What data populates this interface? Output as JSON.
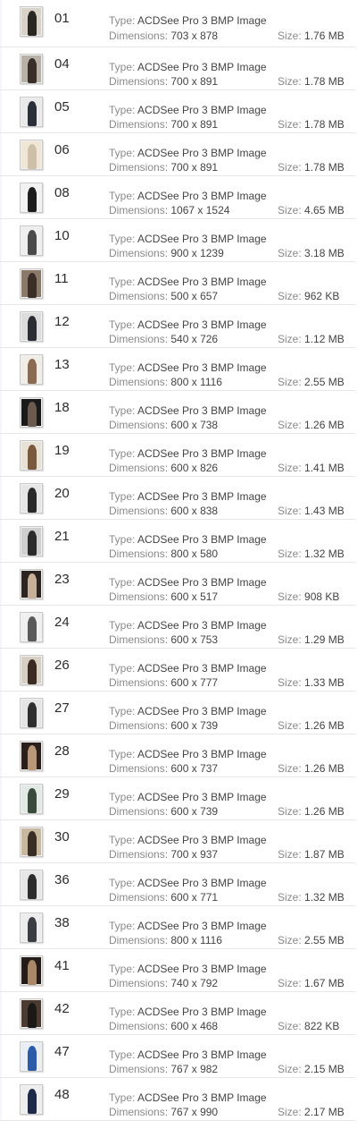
{
  "labels": {
    "type": "Type:",
    "dimensions": "Dimensions:",
    "size": "Size:"
  },
  "files": [
    {
      "name": "01",
      "type": "ACDSee Pro 3 BMP Image",
      "dimensions": "703 x 878",
      "size": "1.76 MB"
    },
    {
      "name": "04",
      "type": "ACDSee Pro 3 BMP Image",
      "dimensions": "700 x 891",
      "size": "1.78 MB"
    },
    {
      "name": "05",
      "type": "ACDSee Pro 3 BMP Image",
      "dimensions": "700 x 891",
      "size": "1.78 MB"
    },
    {
      "name": "06",
      "type": "ACDSee Pro 3 BMP Image",
      "dimensions": "700 x 891",
      "size": "1.78 MB"
    },
    {
      "name": "08",
      "type": "ACDSee Pro 3 BMP Image",
      "dimensions": "1067 x 1524",
      "size": "4.65 MB"
    },
    {
      "name": "10",
      "type": "ACDSee Pro 3 BMP Image",
      "dimensions": "900 x 1239",
      "size": "3.18 MB"
    },
    {
      "name": "11",
      "type": "ACDSee Pro 3 BMP Image",
      "dimensions": "500 x 657",
      "size": "962 KB"
    },
    {
      "name": "12",
      "type": "ACDSee Pro 3 BMP Image",
      "dimensions": "540 x 726",
      "size": "1.12 MB"
    },
    {
      "name": "13",
      "type": "ACDSee Pro 3 BMP Image",
      "dimensions": "800 x 1116",
      "size": "2.55 MB"
    },
    {
      "name": "18",
      "type": "ACDSee Pro 3 BMP Image",
      "dimensions": "600 x 738",
      "size": "1.26 MB"
    },
    {
      "name": "19",
      "type": "ACDSee Pro 3 BMP Image",
      "dimensions": "600 x 826",
      "size": "1.41 MB"
    },
    {
      "name": "20",
      "type": "ACDSee Pro 3 BMP Image",
      "dimensions": "600 x 838",
      "size": "1.43 MB"
    },
    {
      "name": "21",
      "type": "ACDSee Pro 3 BMP Image",
      "dimensions": "800 x 580",
      "size": "1.32 MB"
    },
    {
      "name": "23",
      "type": "ACDSee Pro 3 BMP Image",
      "dimensions": "600 x 517",
      "size": "908 KB"
    },
    {
      "name": "24",
      "type": "ACDSee Pro 3 BMP Image",
      "dimensions": "600 x 753",
      "size": "1.29 MB"
    },
    {
      "name": "26",
      "type": "ACDSee Pro 3 BMP Image",
      "dimensions": "600 x 777",
      "size": "1.33 MB"
    },
    {
      "name": "27",
      "type": "ACDSee Pro 3 BMP Image",
      "dimensions": "600 x 739",
      "size": "1.26 MB"
    },
    {
      "name": "28",
      "type": "ACDSee Pro 3 BMP Image",
      "dimensions": "600 x 737",
      "size": "1.26 MB"
    },
    {
      "name": "29",
      "type": "ACDSee Pro 3 BMP Image",
      "dimensions": "600 x 739",
      "size": "1.26 MB"
    },
    {
      "name": "30",
      "type": "ACDSee Pro 3 BMP Image",
      "dimensions": "700 x 937",
      "size": "1.87 MB"
    },
    {
      "name": "36",
      "type": "ACDSee Pro 3 BMP Image",
      "dimensions": "600 x 771",
      "size": "1.32 MB"
    },
    {
      "name": "38",
      "type": "ACDSee Pro 3 BMP Image",
      "dimensions": "800 x 1116",
      "size": "2.55 MB"
    },
    {
      "name": "41",
      "type": "ACDSee Pro 3 BMP Image",
      "dimensions": "740 x 792",
      "size": "1.67 MB"
    },
    {
      "name": "42",
      "type": "ACDSee Pro 3 BMP Image",
      "dimensions": "600 x 468",
      "size": "822 KB"
    },
    {
      "name": "47",
      "type": "ACDSee Pro 3 BMP Image",
      "dimensions": "767 x 982",
      "size": "2.15 MB"
    },
    {
      "name": "48",
      "type": "ACDSee Pro 3 BMP Image",
      "dimensions": "767 x 990",
      "size": "2.17 MB"
    }
  ],
  "thumb_colors": [
    {
      "bg": "#d8d2c8",
      "fig": "#2a2622"
    },
    {
      "bg": "#b8b1a8",
      "fig": "#3a2e28"
    },
    {
      "bg": "#e9e9e9",
      "fig": "#2b2f3a"
    },
    {
      "bg": "#efe6d6",
      "fig": "#cdbfa8"
    },
    {
      "bg": "#f2f2f2",
      "fig": "#1e1e1e"
    },
    {
      "bg": "#eeeeee",
      "fig": "#4a4a4a"
    },
    {
      "bg": "#8a7a6a",
      "fig": "#3b2e26"
    },
    {
      "bg": "#dcdcdc",
      "fig": "#2c2c34"
    },
    {
      "bg": "#f0ece6",
      "fig": "#8a6a50"
    },
    {
      "bg": "#1a1a1a",
      "fig": "#6a5a50"
    },
    {
      "bg": "#e8e1d6",
      "fig": "#7a5a3c"
    },
    {
      "bg": "#e6e6e6",
      "fig": "#2a2a2a"
    },
    {
      "bg": "#cfcfcf",
      "fig": "#2b2b2b"
    },
    {
      "bg": "#2b2420",
      "fig": "#c8b098"
    },
    {
      "bg": "#efefef",
      "fig": "#5a5a5a"
    },
    {
      "bg": "#d8cfc4",
      "fig": "#3a2a22"
    },
    {
      "bg": "#e4e4e4",
      "fig": "#2e2e2e"
    },
    {
      "bg": "#2a1f1a",
      "fig": "#b89878"
    },
    {
      "bg": "#e2e8e4",
      "fig": "#3a4a3c"
    },
    {
      "bg": "#c8b8a0",
      "fig": "#3a2e24"
    },
    {
      "bg": "#e6e6e6",
      "fig": "#2c2c2c"
    },
    {
      "bg": "#ececec",
      "fig": "#3c3c44"
    },
    {
      "bg": "#241c18",
      "fig": "#a88868"
    },
    {
      "bg": "#4a3a30",
      "fig": "#1c1816"
    },
    {
      "bg": "#e8eef4",
      "fig": "#2a5aa8"
    },
    {
      "bg": "#eeeeee",
      "fig": "#1e2a4a"
    }
  ]
}
